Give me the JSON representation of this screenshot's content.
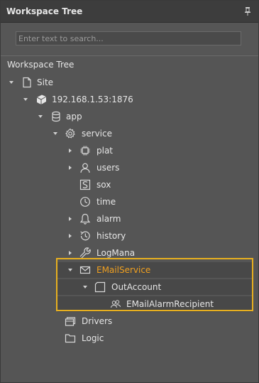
{
  "panel": {
    "title": "Workspace Tree",
    "pin_icon": "pin-icon"
  },
  "search": {
    "placeholder": "Enter text to search..."
  },
  "section": {
    "title": "Workspace Tree"
  },
  "tree": {
    "site": "Site",
    "device": "192.168.1.53:1876",
    "app": "app",
    "service": "service",
    "plat": "plat",
    "users": "users",
    "sox": "sox",
    "time": "time",
    "alarm": "alarm",
    "history": "history",
    "logmana": "LogMana",
    "emailservice": "EMailService",
    "outaccount": "OutAccount",
    "emailalarmrecipient": "EMailAlarmRecipient",
    "drivers": "Drivers",
    "logic": "Logic"
  },
  "colors": {
    "highlight": "#e8b020",
    "selected_text": "#f0a020"
  }
}
